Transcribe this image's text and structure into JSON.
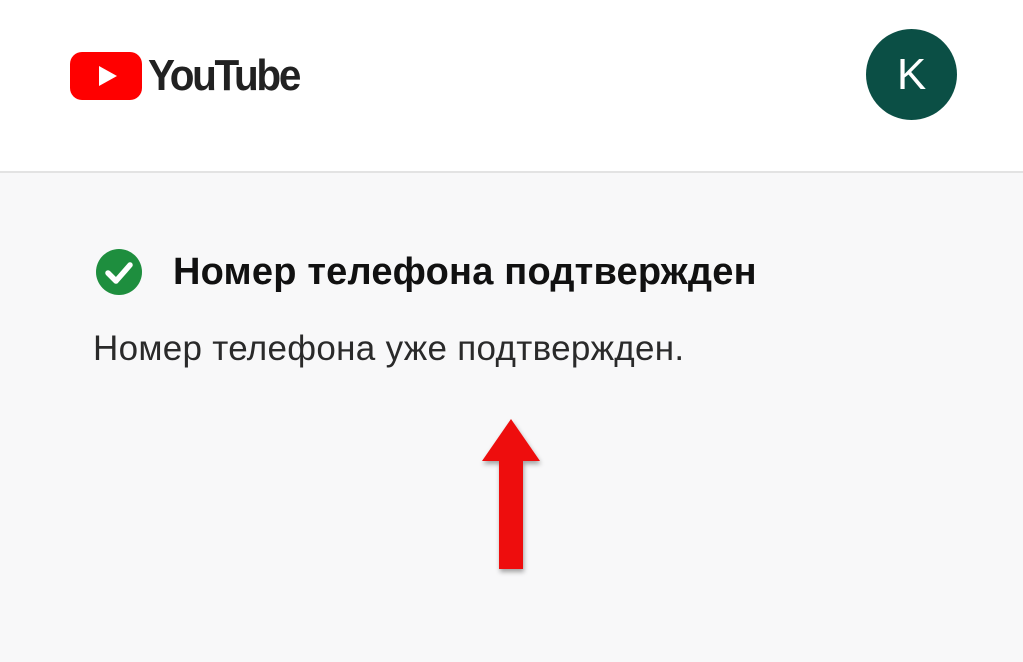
{
  "header": {
    "brand": "YouTube",
    "brand_color": "#ff0000",
    "avatar_letter": "K",
    "avatar_color": "#0b4f45"
  },
  "notice": {
    "icon": "check-circle-icon",
    "icon_color": "#1e8e3e",
    "title": "Номер телефона подтвержден",
    "message": "Номер телефона уже подтвержден."
  },
  "annotation": {
    "icon": "red-up-arrow",
    "color": "#ee1111"
  }
}
